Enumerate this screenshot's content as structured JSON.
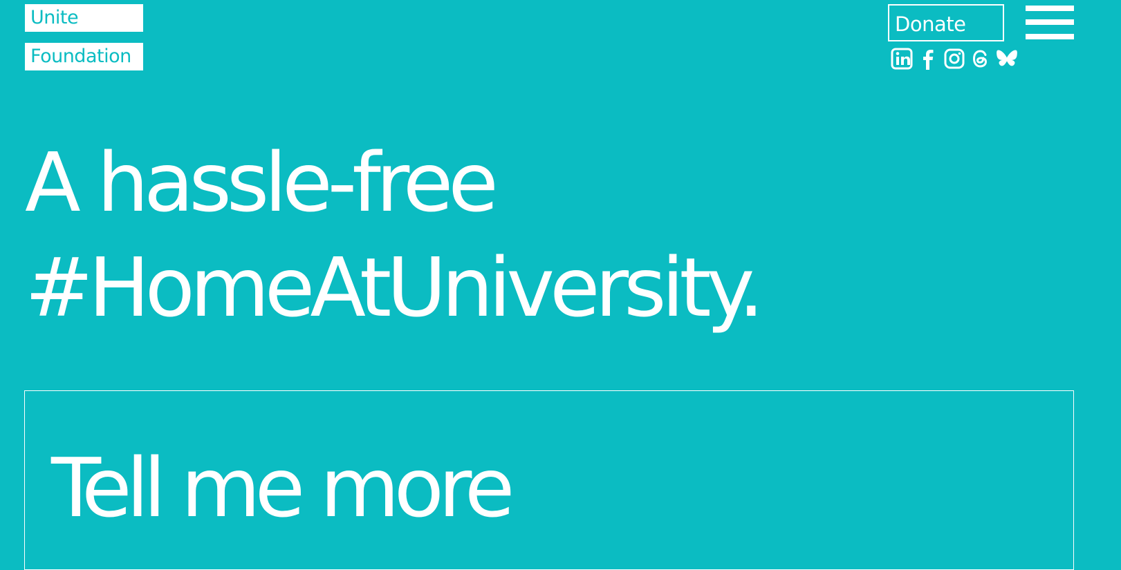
{
  "logo": {
    "line1": "Unite",
    "line2": "Foundation"
  },
  "header": {
    "donate_label": "Donate"
  },
  "socials": [
    {
      "icon": "linkedin-icon"
    },
    {
      "icon": "facebook-icon"
    },
    {
      "icon": "instagram-icon"
    },
    {
      "icon": "threads-icon"
    },
    {
      "icon": "bluesky-icon"
    }
  ],
  "hero": {
    "line1": "A hassle-free",
    "line2": "#HomeAtUniversity."
  },
  "cta": {
    "label": "Tell me more"
  },
  "colors": {
    "background": "#0bbcc2",
    "foreground": "#ffffff"
  }
}
